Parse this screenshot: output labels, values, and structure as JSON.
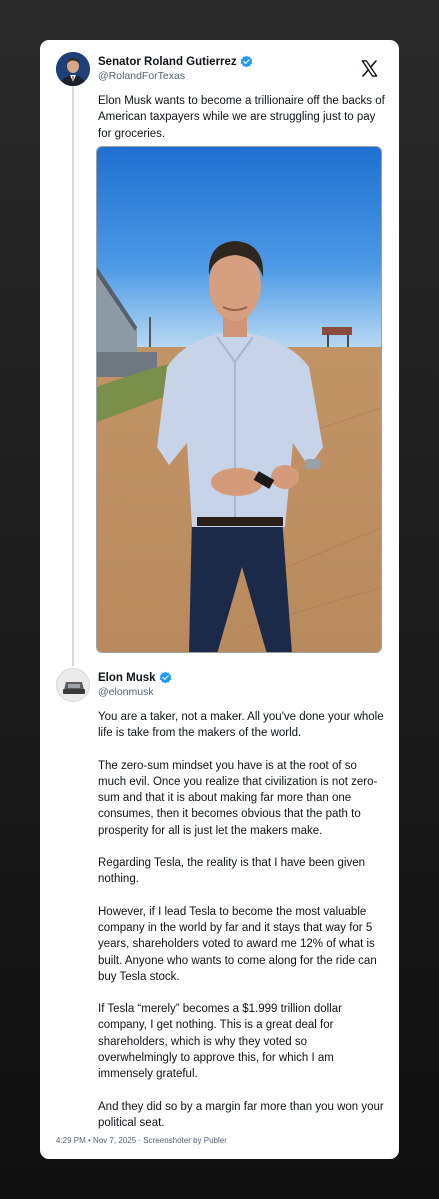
{
  "tweet1": {
    "author": "Senator Roland Gutierrez",
    "handle": "@RolandForTexas",
    "text": "Elon Musk wants to become a trillionaire off the backs of American taxpayers while we are struggling just to pay for groceries."
  },
  "tweet2": {
    "author": "Elon Musk",
    "handle": "@elonmusk",
    "paragraphs": [
      "You are a taker, not a maker. All you've done your whole life is take from the makers of the world.",
      "The zero-sum mindset you have is at the root of so much evil. Once you realize that civilization is not zero-sum and that it is about making far more than one consumes, then it becomes obvious that the path to prosperity for all is just let the makers make.",
      "Regarding Tesla, the reality is that I have been given nothing.",
      "However, if I lead Tesla to become the most valuable company in the world by far and it stays that way for 5 years, shareholders voted to award me 12% of what is built. Anyone who wants to come along for the ride can buy Tesla stock.",
      "If Tesla “merely” becomes a $1.999 trillion dollar company, I get nothing. This is a great deal for shareholders, which is why they voted so overwhelmingly to approve this, for which I am immensely grateful.",
      "And they did so by a margin far more than you won your political seat."
    ]
  },
  "footer": "4:29 PM • Nov 7, 2025 · Screenshoter by Publer",
  "icons": {
    "verified": "verified-badge-icon",
    "platform": "x-logo-icon"
  },
  "colors": {
    "verified": "#1d9bf0",
    "text": "#0f1419",
    "secondary": "#536471",
    "sky": "#2b7fd6"
  }
}
